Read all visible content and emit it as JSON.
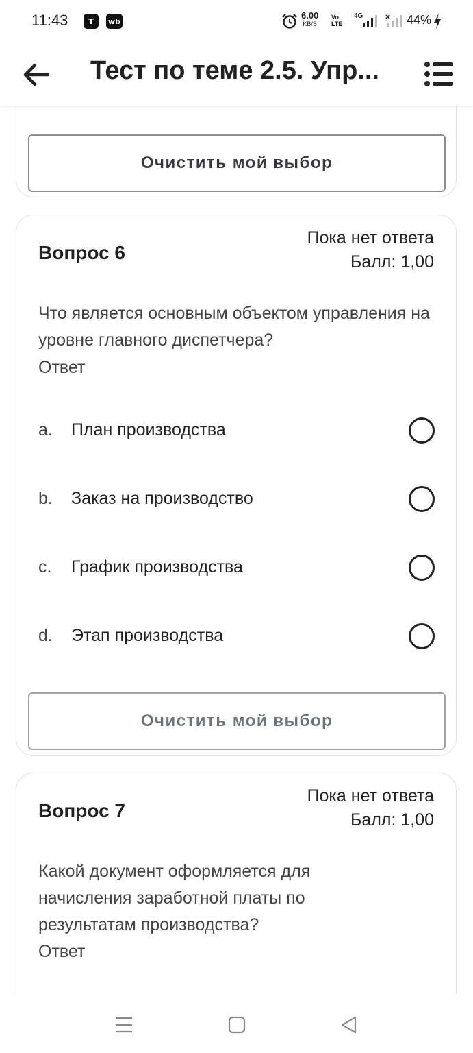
{
  "status_bar": {
    "time": "11:43",
    "app_icon_1": "T",
    "app_icon_2": "wb",
    "speed_value": "6.00",
    "speed_unit": "KB/S",
    "volte_line1": "Vo",
    "volte_line2": "LTE",
    "network": "4G",
    "battery": "44%"
  },
  "header": {
    "title": "Тест по теме 2.5. Упр..."
  },
  "prev_card": {
    "clear_label": "Очистить мой выбор"
  },
  "question6": {
    "title": "Вопрос 6",
    "state": "Пока нет ответа",
    "grade": "Балл: 1,00",
    "text": "Что является основным объектом управления на уровне главного диспетчера?",
    "answer_label": "Ответ",
    "options": [
      {
        "letter": "a.",
        "text": "План производства"
      },
      {
        "letter": "b.",
        "text": "Заказ на производство"
      },
      {
        "letter": "c.",
        "text": "График производства"
      },
      {
        "letter": "d.",
        "text": "Этап производства"
      }
    ],
    "clear_label": "Очистить мой выбор"
  },
  "question7": {
    "title": "Вопрос 7",
    "state": "Пока нет ответа",
    "grade": "Балл: 1,00",
    "text": "Какой документ оформляется для начисления заработной платы по результатам производства?",
    "answer_label": "Ответ"
  },
  "icons": {
    "back": "arrow-left-icon",
    "menu": "list-icon",
    "nav_recents": "menu-lines-icon",
    "nav_home": "square-icon",
    "nav_back": "triangle-back-icon"
  }
}
